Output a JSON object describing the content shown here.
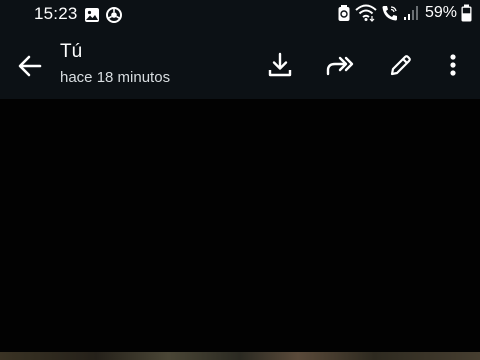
{
  "status_bar": {
    "time": "15:23",
    "battery_percent": "59%",
    "left_icons": [
      "gallery-icon",
      "chrome-icon"
    ],
    "right_icons": [
      "battery-saver-icon",
      "wifi-icon",
      "wifi-calling-icon",
      "signal-icon",
      "battery-icon"
    ]
  },
  "header": {
    "title": "Tú",
    "subtitle": "hace 18 minutos",
    "actions": [
      "download",
      "forward",
      "edit",
      "more-options"
    ]
  },
  "colors": {
    "bar_background": "#0c1115",
    "page_background": "#020202",
    "icon_color": "#ffffff"
  }
}
